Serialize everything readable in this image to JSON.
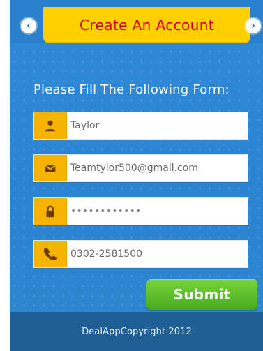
{
  "header": {
    "title": "Create An Account",
    "nav_left_icon": "chevron-left-icon",
    "nav_right_icon": "chevron-right-icon"
  },
  "form": {
    "prompt": "Please Fill The Following Form:",
    "fields": [
      {
        "name": "name-field",
        "icon": "user-icon",
        "value": "Taylor"
      },
      {
        "name": "email-field",
        "icon": "mail-icon",
        "value": "Teamtylor500@gmail.com"
      },
      {
        "name": "password-field",
        "icon": "lock-icon",
        "value": "••••••••••••"
      },
      {
        "name": "phone-field",
        "icon": "phone-icon",
        "value": "0302-2581500"
      }
    ],
    "submit_label": "Submit"
  },
  "footer": {
    "text": "DealAppCopyright 2012"
  },
  "colors": {
    "panel_blue": "#2f8ad7",
    "title_yellow": "#ffd000",
    "title_red": "#d40000",
    "icon_yellow": "#f4b400",
    "submit_green": "#47aa1f",
    "footer_blue": "#1f5f93"
  }
}
